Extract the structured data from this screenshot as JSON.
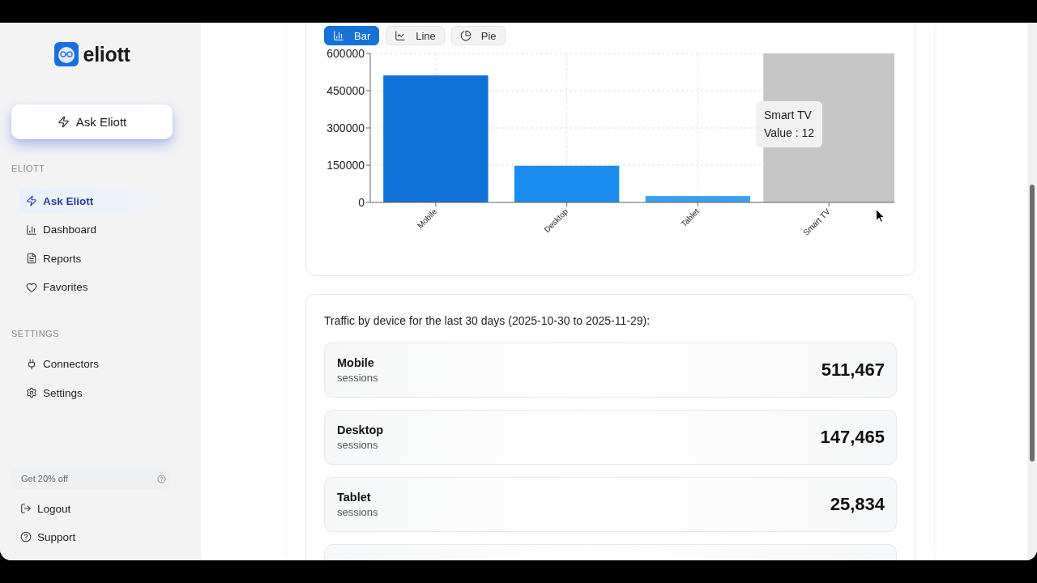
{
  "logo": {
    "text": "eliott"
  },
  "sidebar": {
    "ask_button": {
      "label": "Ask Eliott"
    },
    "sections": [
      {
        "title": "ELIOTT",
        "items": [
          {
            "label": "Ask Eliott",
            "selected": true
          },
          {
            "label": "Dashboard",
            "selected": false
          },
          {
            "label": "Reports",
            "selected": false
          },
          {
            "label": "Favorites",
            "selected": false
          }
        ]
      },
      {
        "title": "SETTINGS",
        "items": [
          {
            "label": "Connectors",
            "selected": false
          },
          {
            "label": "Settings",
            "selected": false
          }
        ]
      }
    ],
    "promo": {
      "label": "Get 20% off"
    },
    "footer_items": [
      {
        "label": "Logout"
      },
      {
        "label": "Support"
      }
    ]
  },
  "chart_card": {
    "tabs": [
      {
        "label": "Bar",
        "selected": true
      },
      {
        "label": "Line",
        "selected": false
      },
      {
        "label": "Pie",
        "selected": false
      }
    ],
    "chart_data": {
      "type": "bar",
      "categories": [
        "Mobile",
        "Desktop",
        "Tablet",
        "Smart TV"
      ],
      "series": [
        {
          "color": "#0e72d8",
          "values": [
            511467,
            null,
            null,
            null
          ]
        },
        {
          "color": "#1a8cf0",
          "values": [
            null,
            147465,
            null,
            null
          ]
        },
        {
          "color": "#3d9ff0",
          "values": [
            null,
            null,
            25834,
            null
          ]
        },
        {
          "values": [
            null,
            null,
            null,
            12
          ]
        }
      ],
      "stacked": true,
      "ylim": [
        0,
        600000
      ],
      "yticks": [
        0,
        150000,
        300000,
        450000,
        600000
      ],
      "grid": true,
      "bands": [
        {
          "axis": "x",
          "from": "Smart TV",
          "to": "Smart TV",
          "color": "#c6c6c6"
        }
      ]
    },
    "tooltip": {
      "title": "Smart TV",
      "text": "Value : 12"
    }
  },
  "summary_card": {
    "text": "Traffic by device for the last 30 days (2025-10-30 to 2025-11-29):",
    "rows": [
      {
        "kind": "full",
        "name": "Mobile",
        "unit": "sessions",
        "value": "511,467"
      },
      {
        "kind": "full",
        "name": "Desktop",
        "unit": "sessions",
        "value": "147,465"
      },
      {
        "kind": "full",
        "name": "Tablet",
        "unit": "sessions",
        "value": "25,834"
      },
      {
        "kind": "clipped"
      }
    ]
  }
}
